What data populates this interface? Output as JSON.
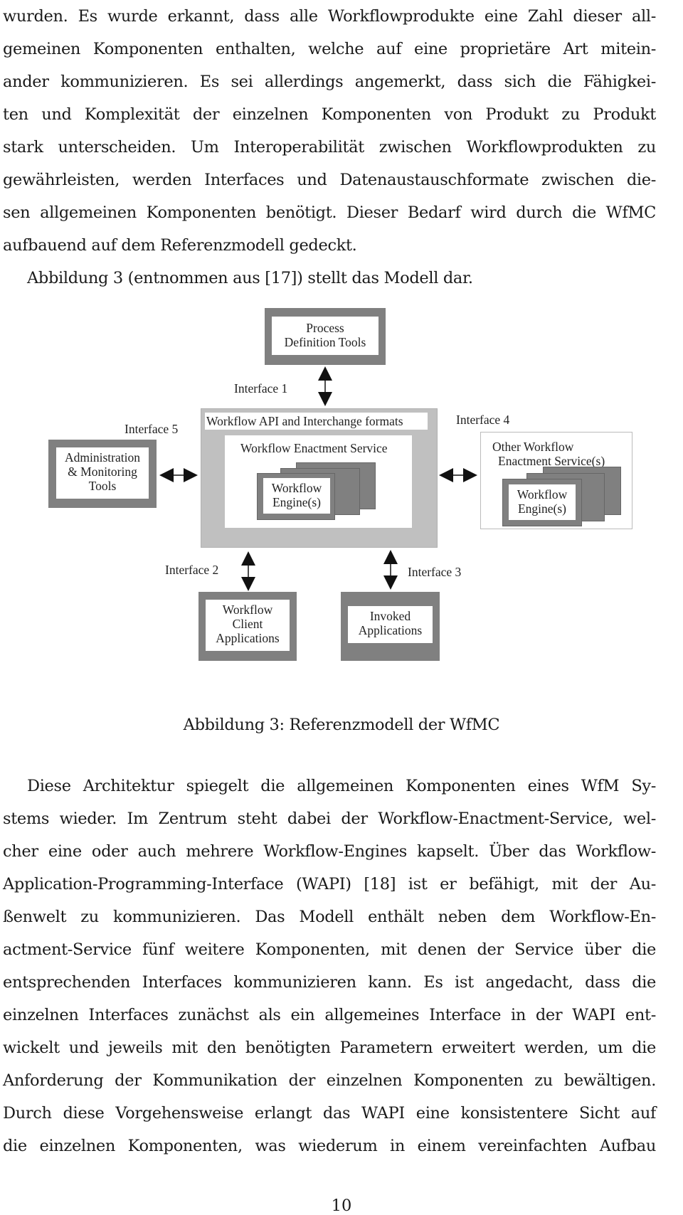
{
  "top_paragraph": {
    "lines": [
      "wurden. Es wurde erkannt, dass alle Workflowprodukte eine Zahl dieser all-",
      "gemeinen Komponenten enthalten, welche auf eine proprietäre Art mitein-",
      "ander kommunizieren. Es sei allerdings angemerkt, dass sich die Fähigkei-",
      "ten und Komplexität der einzelnen Komponenten von Produkt zu Produkt",
      "stark unterscheiden. Um Interoperabilität zwischen Workflowprodukten zu",
      "gewährleisten, werden Interfaces und Datenaustauschformate zwischen die-",
      "sen allgemeinen Komponenten benötigt. Dieser Bedarf wird durch die WfMC",
      "aufbauend auf dem Referenzmodell gedeckt."
    ],
    "figure_ref_line": "Abbildung 3 (entnommen aus [17]) stellt das Modell dar."
  },
  "figure": {
    "process_definition_tools": [
      "Process",
      "Definition Tools"
    ],
    "workflow_api": "Workflow API and Interchange formats",
    "enactment_service": "Workflow Enactment Service",
    "workflow_engine": [
      "Workflow",
      "Engine(s)"
    ],
    "admin_tools": [
      "Administration",
      "& Monitoring",
      "Tools"
    ],
    "other_enactment": [
      "Other Workflow",
      "Enactment Service(s)"
    ],
    "other_engine": [
      "Workflow",
      "Engine(s)"
    ],
    "client_apps": [
      "Workflow",
      "Client",
      "Applications"
    ],
    "invoked_apps": [
      "Invoked",
      "Applications"
    ],
    "interfaces": {
      "i1": "Interface 1",
      "i2": "Interface 2",
      "i3": "Interface 3",
      "i4": "Interface 4",
      "i5": "Interface 5"
    },
    "caption": "Abbildung 3: Referenzmodell der WfMC"
  },
  "bottom_paragraph": {
    "lines": [
      "Diese Architektur spiegelt die allgemeinen Komponenten eines WfM Sy-",
      "stems wieder. Im Zentrum steht dabei der Workflow-Enactment-Service, wel-",
      "cher eine oder auch mehrere Workflow-Engines kapselt. Über das Workflow-",
      "Application-Programming-Interface (WAPI) [18] ist er befähigt, mit der Au-",
      "ßenwelt zu kommunizieren. Das Modell enthält neben dem Workflow-En-",
      "actment-Service fünf weitere Komponenten, mit denen der Service über die",
      "entsprechenden Interfaces kommunizieren kann. Es ist angedacht, dass die",
      "einzelnen Interfaces zunächst als ein allgemeines Interface in der WAPI ent-",
      "wickelt und jeweils mit den benötigten Parametern erweitert werden, um die",
      "Anforderung der Kommunikation der einzelnen Komponenten zu bewältigen.",
      "Durch diese Vorgehensweise erlangt das WAPI eine konsistentere Sicht auf",
      "die einzelnen Komponenten, was wiederum in einem vereinfachten Aufbau"
    ]
  },
  "page_number": "10"
}
